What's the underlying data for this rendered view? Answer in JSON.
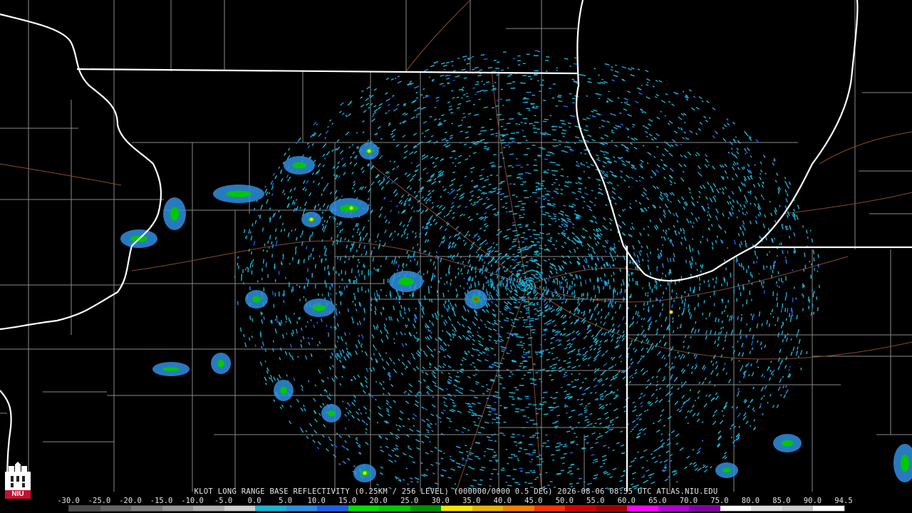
{
  "map": {
    "colors": {
      "background": "#000000",
      "state_border": "#ffffff",
      "county_border": "#8a8a8a",
      "road": "#8b4a2b"
    },
    "echo_palette": [
      "#1ab4d4",
      "#2f8fe0",
      "#1f5fe8",
      "#00c800",
      "#00a000"
    ],
    "hotspot_colors": [
      "#f5e400",
      "#ff2a2a"
    ]
  },
  "caption": "KLOT LONG RANGE BASE REFLECTIVITY (0.25KM / 256 LEVEL) (000000/0000 0.5 DEG) 2026-08-06 08:55 UTC  ATLAS.NIU.EDU",
  "colorbar": {
    "ticks": [
      "-30.0",
      "-25.0",
      "-20.0",
      "-15.0",
      "-10.0",
      "-5.0",
      "0.0",
      "5.0",
      "10.0",
      "15.0",
      "20.0",
      "25.0",
      "30.0",
      "35.0",
      "40.0",
      "45.0",
      "50.0",
      "55.0",
      "60.0",
      "65.0",
      "70.0",
      "75.0",
      "80.0",
      "85.0",
      "90.0",
      "94.5"
    ],
    "colors": [
      "#4a4a4a",
      "#666666",
      "#7f7f7f",
      "#999999",
      "#b2b2b2",
      "#cfcfcf",
      "#1ab4d4",
      "#2f8fe0",
      "#1f5fe8",
      "#00e000",
      "#00c800",
      "#009000",
      "#f5e400",
      "#e8b400",
      "#f08000",
      "#ff3000",
      "#d00000",
      "#a00000",
      "#ff00ff",
      "#b000d0",
      "#8000a0",
      "#ffffff",
      "#dddddd",
      "#cccccc",
      "#ffffff"
    ]
  },
  "logo": {
    "text": "NIU",
    "color": "#c8102e"
  }
}
